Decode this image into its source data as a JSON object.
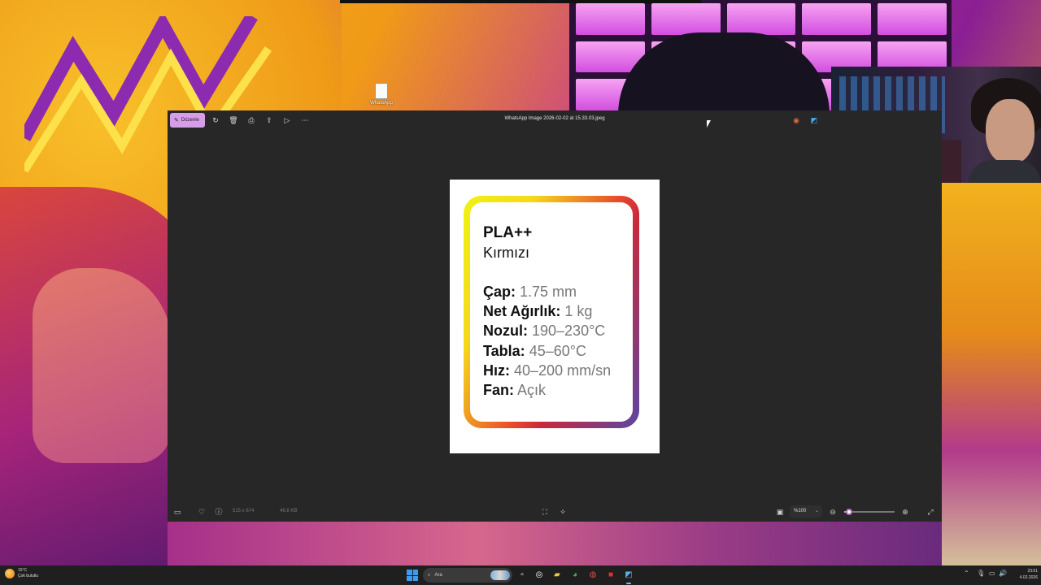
{
  "desktop": {
    "icon_label": "WhatsApp"
  },
  "app": {
    "edit_label": "Düzenle",
    "title": "WhatsApp Image 2026-02-02 at 15.33.03.jpeg",
    "toolbar_icons": [
      "rotate-icon",
      "delete-icon",
      "print-icon",
      "share-icon",
      "slideshow-icon",
      "more-icon"
    ],
    "status": {
      "dimensions": "515 x 674",
      "filesize": "46.8 KB",
      "zoom": "%100",
      "zoom_level_fraction": 0.1
    }
  },
  "label_card": {
    "title": "PLA++",
    "color": "Kırmızı",
    "specs": [
      {
        "key": "Çap:",
        "value": "1.75 mm"
      },
      {
        "key": "Net Ağırlık:",
        "value": "1 kg"
      },
      {
        "key": "Nozul:",
        "value": "190–230°C"
      },
      {
        "key": "Tabla:",
        "value": "45–60°C"
      },
      {
        "key": "Hız:",
        "value": "40–200 mm/sn"
      },
      {
        "key": "Fan:",
        "value": "Açık"
      }
    ],
    "gradient_colors": [
      "#f0f214",
      "#e94a2a",
      "#c8293c",
      "#5a47a2"
    ]
  },
  "taskbar": {
    "weather_temp": "15°C",
    "weather_desc": "Çok bulutlu",
    "search_placeholder": "Ara",
    "time": "23:51",
    "date": "4.02.2026"
  },
  "colors": {
    "accent": "#d59ee6",
    "app_bg": "#272727",
    "taskbar_bg": "#1f1f1f"
  }
}
